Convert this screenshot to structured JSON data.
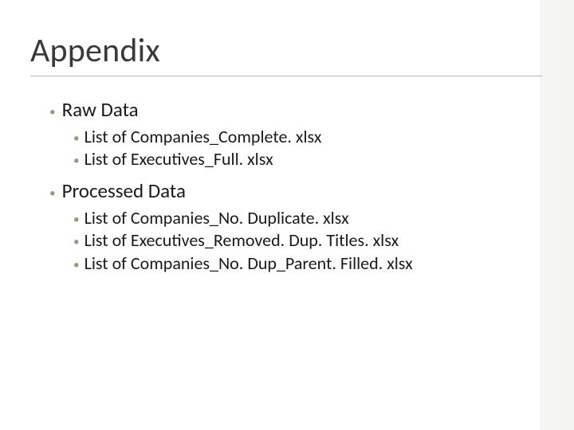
{
  "title": "Appendix",
  "sections": [
    {
      "heading": "Raw Data",
      "items": [
        "List of Companies_Complete. xlsx",
        "List of Executives_Full. xlsx"
      ]
    },
    {
      "heading": "Processed Data",
      "items": [
        "List of Companies_No. Duplicate. xlsx",
        "List of Executives_Removed. Dup. Titles. xlsx",
        "List of Companies_No. Dup_Parent. Filled. xlsx"
      ]
    }
  ]
}
